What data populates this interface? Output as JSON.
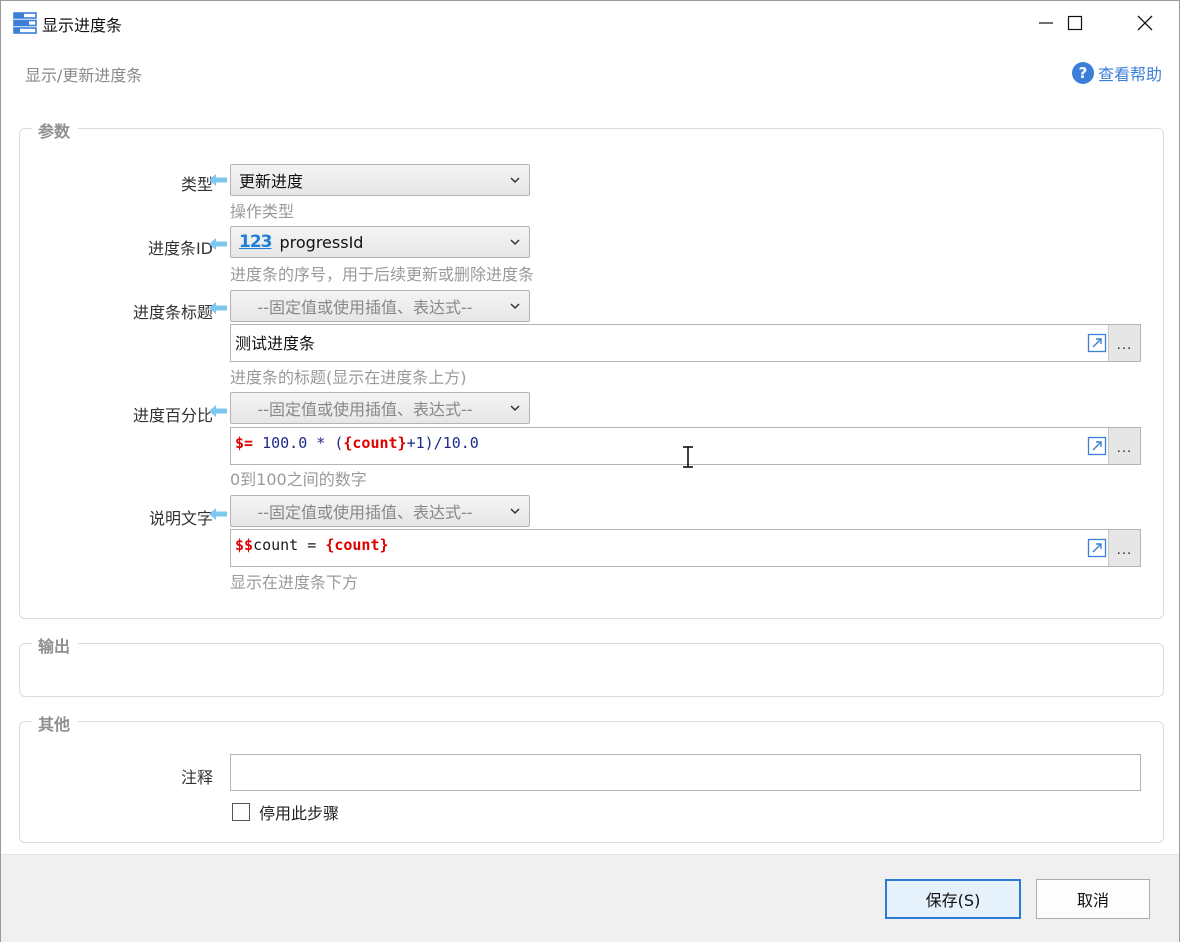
{
  "window": {
    "title": "显示进度条",
    "subtitle": "显示/更新进度条",
    "help_label": "查看帮助",
    "help_glyph": "?"
  },
  "groups": {
    "params_label": "参数",
    "output_label": "输出",
    "other_label": "其他"
  },
  "fields": {
    "type": {
      "label": "类型",
      "value": "更新进度",
      "hint": "操作类型"
    },
    "progress_id": {
      "label": "进度条ID",
      "icon_text": "123",
      "value": "progressId",
      "hint": "进度条的序号，用于后续更新或删除进度条"
    },
    "progress_title": {
      "label": "进度条标题",
      "mode": "--固定值或使用插值、表达式--",
      "text": "测试进度条",
      "hint": "进度条的标题(显示在进度条上方)"
    },
    "progress_percent": {
      "label": "进度百分比",
      "mode": "--固定值或使用插值、表达式--",
      "expr_prefix": "$=",
      "expr_a": " 100.0 * (",
      "expr_var": "{count}",
      "expr_b": "+1)/10.0",
      "hint": "0到100之间的数字"
    },
    "description": {
      "label": "说明文字",
      "mode": "--固定值或使用插值、表达式--",
      "expr_prefix": "$$",
      "expr_a": "count = ",
      "expr_var": "{count}",
      "hint": "显示在进度条下方"
    },
    "comment": {
      "label": "注释",
      "value": ""
    },
    "disable_step": {
      "label": "停用此步骤",
      "checked": false
    }
  },
  "buttons": {
    "dots": "...",
    "save": "保存(S)",
    "cancel": "取消"
  },
  "colors": {
    "accent": "#3c7fd8",
    "arrow": "#7cc8f0",
    "keyword": "#e00000"
  }
}
